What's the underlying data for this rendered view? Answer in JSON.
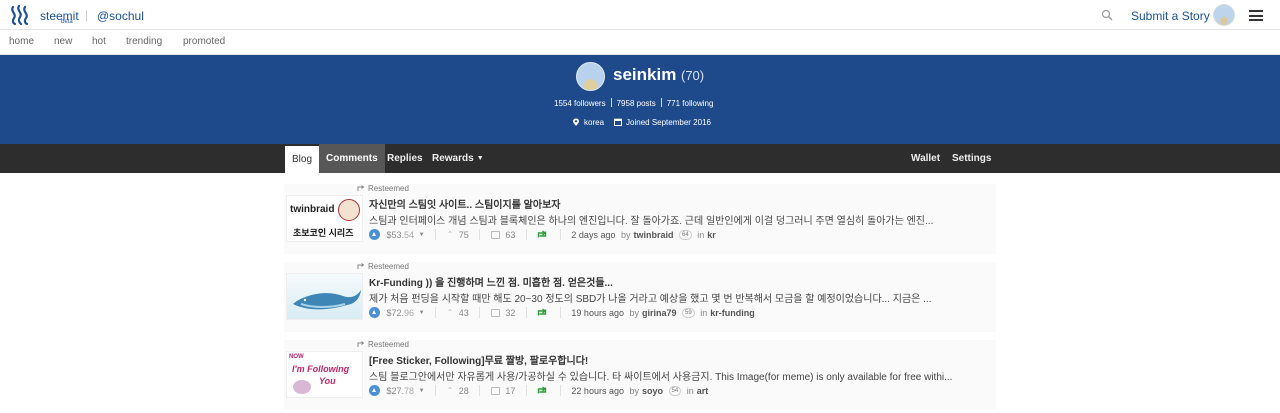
{
  "header": {
    "brand": "steemit",
    "beta": "beta",
    "separator": "|",
    "user_handle": "@sochul",
    "submit_label": "Submit a Story"
  },
  "nav": {
    "items": [
      "home",
      "new",
      "hot",
      "trending",
      "promoted"
    ]
  },
  "profile": {
    "name": "seinkim",
    "reputation": "(70)",
    "followers": "1554 followers",
    "posts": "7958 posts",
    "following": "771 following",
    "location": "korea",
    "joined": "Joined September 2016"
  },
  "tabs": {
    "blog": "Blog",
    "comments": "Comments",
    "replies": "Replies",
    "rewards": "Rewards",
    "wallet": "Wallet",
    "settings": "Settings"
  },
  "colors": {
    "banner": "#1e4a8c",
    "tabbar": "#2d2d2d",
    "link": "#1a5099",
    "upvote": "#4b90d4",
    "resteem": "#2e9e3a"
  },
  "posts": [
    {
      "resteemed": "Resteemed",
      "title": "자신만의 스팀잇 사이트.. 스팀이지를 알아보자",
      "body": "스팀과 인터페이스 개념 스팀과 블록체인은 하나의 엔진입니다. 잘 돌아가죠. 근데 일반인에게 이걸 덩그러니 주면 열심히 돌아가는 엔진...",
      "payout_main": "$53.",
      "payout_cents": "54",
      "votes": "75",
      "comments": "63",
      "time": "2 days ago",
      "by": "by",
      "author": "twinbraid",
      "author_rep": "64",
      "in": "in",
      "category": "kr",
      "thumb_line1": "twinbraid",
      "thumb_line2": "초보코인 시리즈"
    },
    {
      "resteemed": "Resteemed",
      "title": "Kr-Funding )) 을 진행하며 느낀 점. 미흡한 점. 얻은것들...",
      "body": "제가 처음 펀딩을 시작할 때만 해도 20~30 정도의 SBD가 나올 거라고 예상을 했고 몇 번 반복해서 모금을 할 예정이었습니다... 지금은 ...",
      "payout_main": "$72.",
      "payout_cents": "96",
      "votes": "43",
      "comments": "32",
      "time": "19 hours ago",
      "by": "by",
      "author": "girina79",
      "author_rep": "59",
      "in": "in",
      "category": "kr-funding"
    },
    {
      "resteemed": "Resteemed",
      "title": "[Free Sticker, Following]무료 짤방, 팔로우합니다!",
      "body": "스팀 블로그안에서만 자유롭게 사용/가공하실 수 있습니다. 타 싸이트에서 사용금지. This Image(for meme) is only available for free withi...",
      "payout_main": "$27.",
      "payout_cents": "78",
      "votes": "28",
      "comments": "17",
      "time": "22 hours ago",
      "by": "by",
      "author": "soyo",
      "author_rep": "54",
      "in": "in",
      "category": "art",
      "thumb_line1": "NOW",
      "thumb_line2": "I'm Following",
      "thumb_line3": "You"
    }
  ]
}
